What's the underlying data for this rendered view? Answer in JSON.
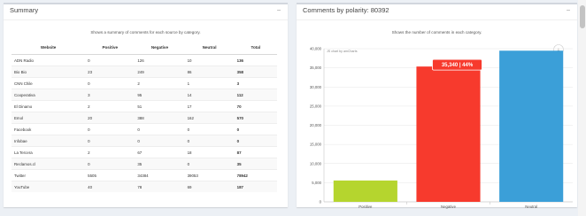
{
  "summary": {
    "title": "Summary",
    "subtitle": "Shows a summary of comments for each source by category.",
    "collapse_icon": "−",
    "columns": [
      "Website",
      "Positive",
      "Negative",
      "Neutral",
      "Total"
    ],
    "rows": [
      [
        "ADN Radio",
        "0",
        "126",
        "10",
        "136"
      ],
      [
        "Bio Bio",
        "23",
        "249",
        "86",
        "358"
      ],
      [
        "CNN Chile",
        "0",
        "2",
        "1",
        "3"
      ],
      [
        "Cooperativa",
        "3",
        "95",
        "14",
        "112"
      ],
      [
        "El Dinamo",
        "2",
        "51",
        "17",
        "70"
      ],
      [
        "Emol",
        "20",
        "388",
        "162",
        "570"
      ],
      [
        "Facebook",
        "0",
        "0",
        "0",
        "0"
      ],
      [
        "Infobae",
        "0",
        "0",
        "0",
        "0"
      ],
      [
        "La Tercera",
        "2",
        "67",
        "18",
        "87"
      ],
      [
        "Reclamos.cl",
        "0",
        "35",
        "0",
        "35"
      ],
      [
        "Twitter",
        "5505",
        "34384",
        "39053",
        "78942"
      ],
      [
        "YouTube",
        "40",
        "78",
        "69",
        "187"
      ]
    ]
  },
  "polarity": {
    "title": "Comments by polarity: 80392",
    "subtitle": "Shows the number of comments in each category.",
    "collapse_icon": "−",
    "download_icon": "⤓",
    "credit": "JS chart by amCharts",
    "tooltip": "35,340 | 44%"
  },
  "chart_data": {
    "type": "bar",
    "categories": [
      "Positive",
      "Negative",
      "Neutral"
    ],
    "values": [
      5573,
      35340,
      39479
    ],
    "colors": [
      "#b5d52e",
      "#f73a2d",
      "#3b9fd8"
    ],
    "ylim": [
      0,
      40000
    ],
    "yticks": [
      0,
      5000,
      10000,
      15000,
      20000,
      25000,
      30000,
      35000,
      40000
    ],
    "ytick_labels": [
      "0",
      "5,000",
      "10,000",
      "15,000",
      "20,000",
      "25,000",
      "30,000",
      "35,000",
      "40,000"
    ],
    "grid": true
  }
}
